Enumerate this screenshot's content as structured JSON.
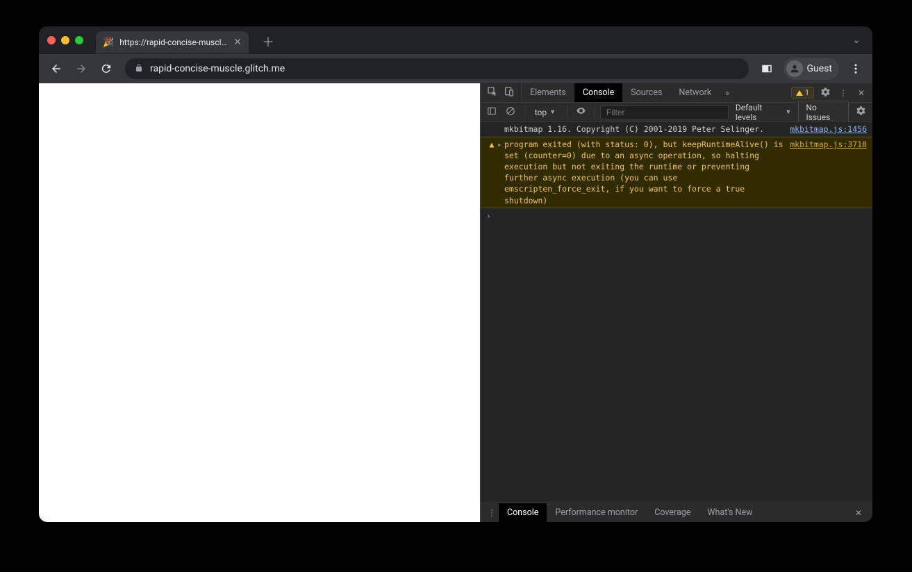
{
  "tab": {
    "favicon": "🎉",
    "title": "https://rapid-concise-muscle.g"
  },
  "toolbar": {
    "url": "rapid-concise-muscle.glitch.me",
    "guest_label": "Guest"
  },
  "devtools": {
    "tabs": [
      "Elements",
      "Console",
      "Sources",
      "Network"
    ],
    "active_tab": "Console",
    "warn_count": "1",
    "filter": {
      "context": "top",
      "placeholder": "Filter",
      "levels": "Default levels",
      "issues": "No Issues"
    },
    "logs": [
      {
        "type": "info",
        "msg": "mkbitmap 1.16. Copyright (C) 2001-2019 Peter Selinger.",
        "src": "mkbitmap.js:1456"
      },
      {
        "type": "warn",
        "msg": "program exited (with status: 0), but keepRuntimeAlive() is set (counter=0) due to an async operation, so halting execution but not exiting the runtime or preventing further async execution (you can use emscripten_force_exit, if you want to force a true shutdown)",
        "src": "mkbitmap.js:3718"
      }
    ],
    "drawer": {
      "tabs": [
        "Console",
        "Performance monitor",
        "Coverage",
        "What's New"
      ],
      "active": "Console"
    }
  }
}
